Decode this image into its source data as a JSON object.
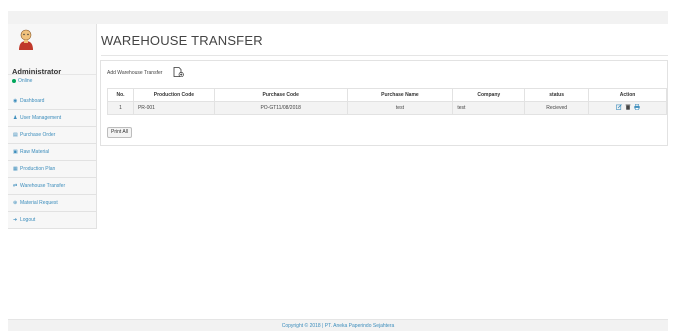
{
  "sidebar": {
    "username": "Administrator",
    "status": "Online",
    "items": [
      {
        "label": "Dashboard",
        "icon": "dashboard-icon"
      },
      {
        "label": "User Management",
        "icon": "user-icon"
      },
      {
        "label": "Purchase Order",
        "icon": "list-icon"
      },
      {
        "label": "Raw Material",
        "icon": "box-icon"
      },
      {
        "label": "Production Plan",
        "icon": "calendar-icon"
      },
      {
        "label": "Warehouse Transfer",
        "icon": "transfer-icon"
      },
      {
        "label": "Material Request",
        "icon": "request-icon"
      },
      {
        "label": "Logout",
        "icon": "logout-icon"
      }
    ]
  },
  "main": {
    "title": "WAREHOUSE TRANSFER",
    "add_label": "Add Warehouse Transfer",
    "print_label": "Print All",
    "table": {
      "headers": [
        "No.",
        "Production Code",
        "Purchase Code",
        "Purchase Name",
        "Company",
        "status",
        "Action"
      ],
      "rows": [
        {
          "no": "1",
          "production_code": "PR-001",
          "purchase_code": "PO-GT11/08/2018",
          "purchase_name": "test",
          "company": "test",
          "status": "Recieved"
        }
      ]
    }
  },
  "footer": {
    "text": "Copyright © 2018 | PT. Aneka Paperindo Sejahtera"
  },
  "colors": {
    "accent": "#3c8dbc",
    "online": "#00a65a"
  }
}
